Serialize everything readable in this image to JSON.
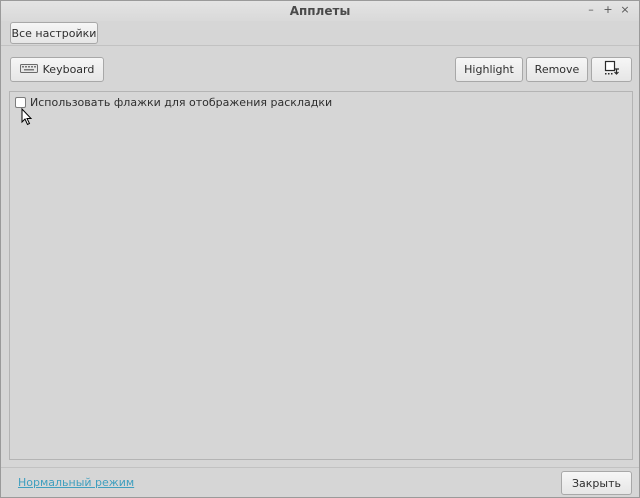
{
  "window": {
    "title": "Апплеты",
    "controls": {
      "minimize": "–",
      "maximize": "+",
      "close": "×"
    }
  },
  "toolbar": {
    "all_settings_label": "Все настройки"
  },
  "actions": {
    "keyboard_label": "Keyboard",
    "highlight_label": "Highlight",
    "remove_label": "Remove"
  },
  "settings": {
    "use_flags_label": "Использовать флажки для отображения раскладки",
    "use_flags_checked": false
  },
  "footer": {
    "normal_mode_label": "Нормальный режим",
    "close_label": "Закрыть"
  }
}
